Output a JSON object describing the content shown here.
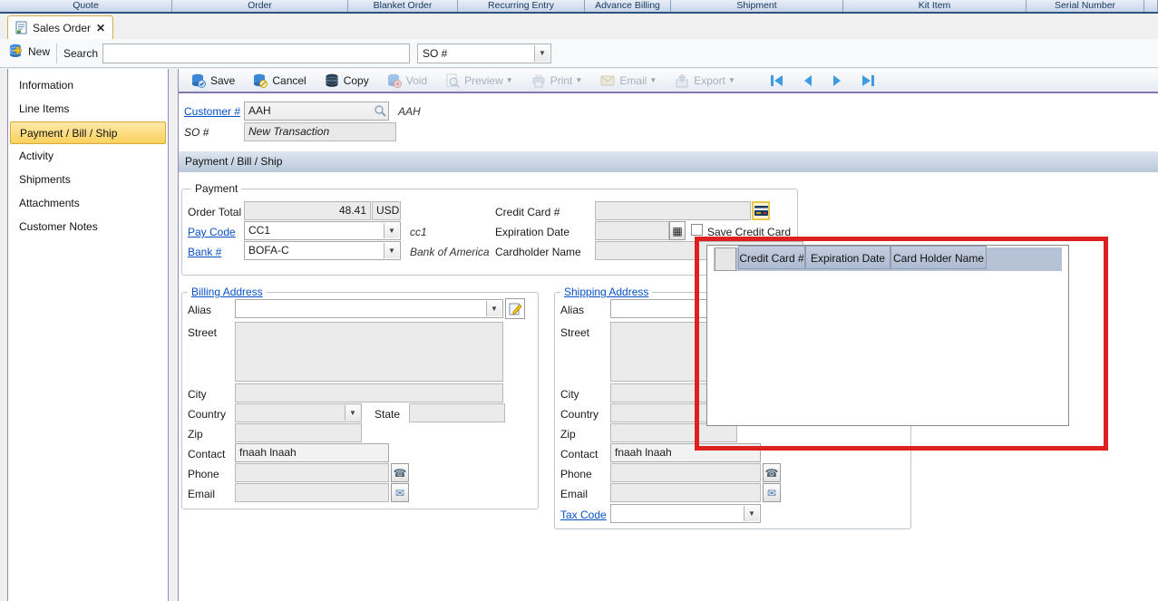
{
  "top_tabs": {
    "items": [
      {
        "label": "Quote"
      },
      {
        "label": "Order"
      },
      {
        "label": "Blanket Order"
      },
      {
        "label": "Recurring Entry"
      },
      {
        "label": "Advance Billing"
      },
      {
        "label": "Shipment"
      },
      {
        "label": "Kit Item"
      },
      {
        "label": "Serial Number"
      }
    ]
  },
  "doc_tab": {
    "label": "Sales Order",
    "close": "✕",
    "icon": "sales-order-document-icon"
  },
  "search_bar": {
    "new_label": "New",
    "new_icon": "database-add-icon",
    "search_label": "Search",
    "search_value": "",
    "search_placeholder": "",
    "filter_value": "SO #"
  },
  "sidebar": {
    "items": [
      {
        "label": "Information",
        "selected": false
      },
      {
        "label": "Line Items",
        "selected": false
      },
      {
        "label": "Payment / Bill / Ship",
        "selected": true
      },
      {
        "label": "Activity",
        "selected": false
      },
      {
        "label": "Shipments",
        "selected": false
      },
      {
        "label": "Attachments",
        "selected": false
      },
      {
        "label": "Customer Notes",
        "selected": false
      }
    ]
  },
  "toolbar": {
    "buttons": [
      {
        "label": "Save",
        "icon": "database-save-icon",
        "disabled": false,
        "dropdown": false
      },
      {
        "label": "Cancel",
        "icon": "database-cancel-icon",
        "disabled": false,
        "dropdown": false
      },
      {
        "label": "Copy",
        "icon": "database-copy-icon",
        "disabled": false,
        "dropdown": false
      },
      {
        "label": "Void",
        "icon": "database-void-icon",
        "disabled": true,
        "dropdown": false
      },
      {
        "label": "Preview",
        "icon": "preview-icon",
        "disabled": true,
        "dropdown": true
      },
      {
        "label": "Print",
        "icon": "print-icon",
        "disabled": true,
        "dropdown": true
      },
      {
        "label": "Email",
        "icon": "email-icon",
        "disabled": true,
        "dropdown": true
      },
      {
        "label": "Export",
        "icon": "export-icon",
        "disabled": true,
        "dropdown": true
      }
    ],
    "nav_icons": [
      "first-record-icon",
      "previous-record-icon",
      "next-record-icon",
      "last-record-icon"
    ],
    "dropdown_glyph": "▼"
  },
  "header_fields": {
    "customer_label": "Customer #",
    "customer_value": "AAH",
    "customer_echo": "AAH",
    "customer_lookup_icon": "magnifier-icon",
    "so_label": "SO #",
    "so_value": "New Transaction"
  },
  "section_header": {
    "title": "Payment / Bill / Ship"
  },
  "payment": {
    "legend": "Payment",
    "order_total_label": "Order Total",
    "order_total_value": "48.41",
    "currency": "USD",
    "pay_code_label": "Pay Code",
    "pay_code_value": "CC1",
    "pay_code_echo": "cc1",
    "bank_label": "Bank #",
    "bank_value": "BOFA-C",
    "bank_echo": "Bank of America",
    "credit_card_label": "Credit Card #",
    "credit_card_value": "",
    "credit_card_icon": "credit-card-icon",
    "expiration_label": "Expiration Date",
    "expiration_value": "",
    "calendar_icon": "calendar-grid-icon",
    "calendar_glyph": "▦",
    "save_cc_label": "Save Credit Card",
    "save_cc_checked": false,
    "holder_label": "Cardholder Name",
    "holder_value": ""
  },
  "billing": {
    "legend": "Billing Address",
    "alias_label": "Alias",
    "alias_value": "",
    "street_label": "Street",
    "street_value": "",
    "city_label": "City",
    "city_value": "",
    "country_label": "Country",
    "country_value": "",
    "state_label": "State",
    "state_value": "",
    "zip_label": "Zip",
    "zip_value": "",
    "contact_label": "Contact",
    "contact_value": "fnaah lnaah",
    "phone_label": "Phone",
    "phone_value": "",
    "phone_icon": "telephone-icon",
    "phone_glyph": "☎",
    "email_label": "Email",
    "email_value": "",
    "email_icon": "envelope-icon",
    "email_glyph": "✉",
    "edit_icon": "edit-address-pencil-icon"
  },
  "shipping": {
    "legend": "Shipping Address",
    "alias_label": "Alias",
    "alias_value": "",
    "street_label": "Street",
    "street_value": "",
    "city_label": "City",
    "city_value": "",
    "country_label": "Country",
    "country_value": "",
    "zip_label": "Zip",
    "zip_value": "",
    "contact_label": "Contact",
    "contact_value": "fnaah lnaah",
    "phone_label": "Phone",
    "phone_value": "",
    "phone_icon": "telephone-icon",
    "phone_glyph": "☎",
    "email_label": "Email",
    "email_value": "",
    "email_icon": "envelope-icon",
    "email_glyph": "✉",
    "tax_code_label": "Tax Code",
    "tax_code_value": ""
  },
  "cc_grid": {
    "columns": [
      "Credit Card #",
      "Expiration Date",
      "Card Holder Name"
    ],
    "rows": []
  },
  "annotation": {
    "shape": "red-highlight-rectangle",
    "color": "#dd2121"
  },
  "colors": {
    "selected_sidebar": "#fbd25e",
    "section_bar": "#c5d2e2",
    "grid_header": "#b6c2d6",
    "top_strip_text": "#17365d",
    "link": "#0651c9",
    "toolbar_border": "#8478ae"
  }
}
